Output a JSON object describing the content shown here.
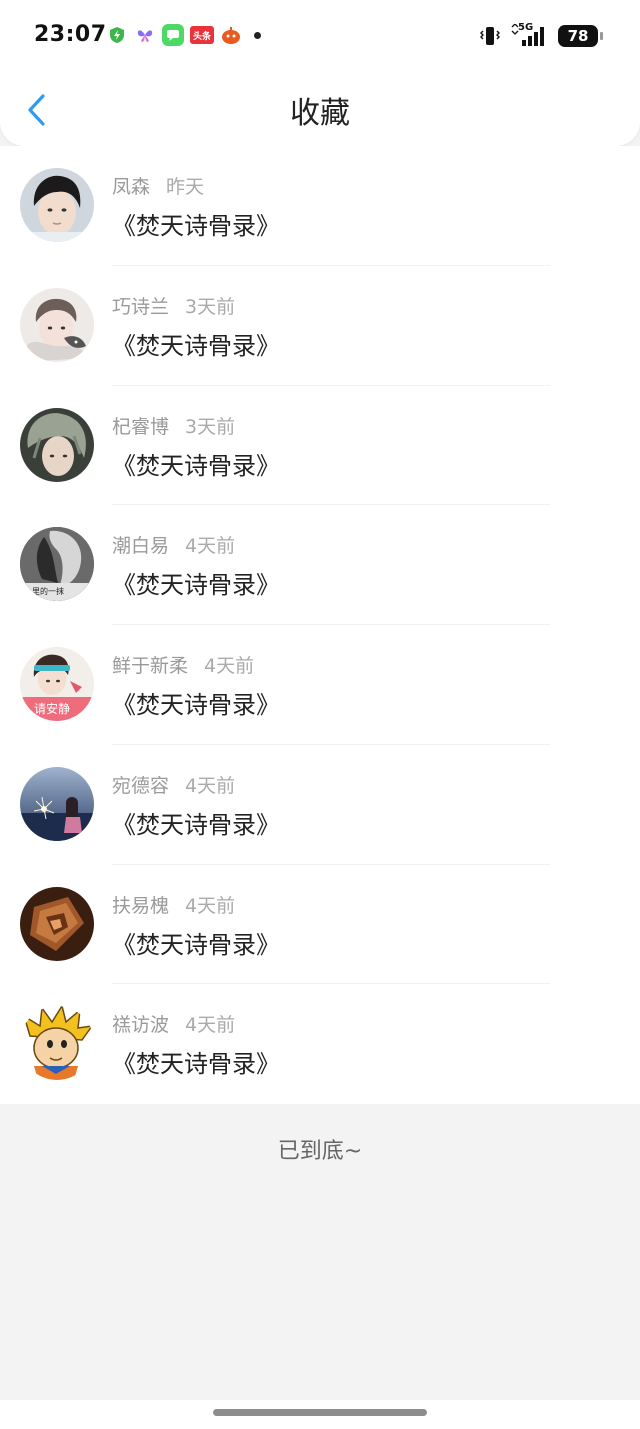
{
  "status_bar": {
    "time": "23:07",
    "signal": "5G",
    "battery": "78",
    "app_icons": [
      {
        "name": "shield-app-icon",
        "color": "#3cb64b"
      },
      {
        "name": "butterfly-app-icon",
        "color": "#8a6cf0"
      },
      {
        "name": "messages-app-icon",
        "color": "#4cd964"
      },
      {
        "name": "toutiao-app-icon",
        "color": "#e8323c",
        "label": "头条"
      },
      {
        "name": "game-app-icon",
        "color": "#e85a1e"
      }
    ]
  },
  "nav": {
    "title": "收藏",
    "back_icon": "chevron-left-icon",
    "accent": "#2e9bf0"
  },
  "list": [
    {
      "user": "凤森",
      "time": "昨天",
      "book": "《焚天诗骨录》",
      "avatar": "boy-portrait"
    },
    {
      "user": "巧诗兰",
      "time": "3天前",
      "book": "《焚天诗骨录》",
      "avatar": "girl-cat-portrait"
    },
    {
      "user": "杞睿博",
      "time": "3天前",
      "book": "《焚天诗骨录》",
      "avatar": "grey-hair-portrait"
    },
    {
      "user": "潮白易",
      "time": "4天前",
      "book": "《焚天诗骨录》",
      "avatar": "bw-portrait"
    },
    {
      "user": "鲜于新柔",
      "time": "4天前",
      "book": "《焚天诗骨录》",
      "avatar": "girl-sign-portrait"
    },
    {
      "user": "宛德容",
      "time": "4天前",
      "book": "《焚天诗骨录》",
      "avatar": "sparkler-night"
    },
    {
      "user": "扶易槐",
      "time": "4天前",
      "book": "《焚天诗骨录》",
      "avatar": "bronze-emblem"
    },
    {
      "user": "禚访波",
      "time": "4天前",
      "book": "《焚天诗骨录》",
      "avatar": "cartoon-goku"
    }
  ],
  "avatar_texts": {
    "bw": "心里的一抹",
    "sign": "请安静"
  },
  "footer": {
    "end_text": "已到底~"
  }
}
